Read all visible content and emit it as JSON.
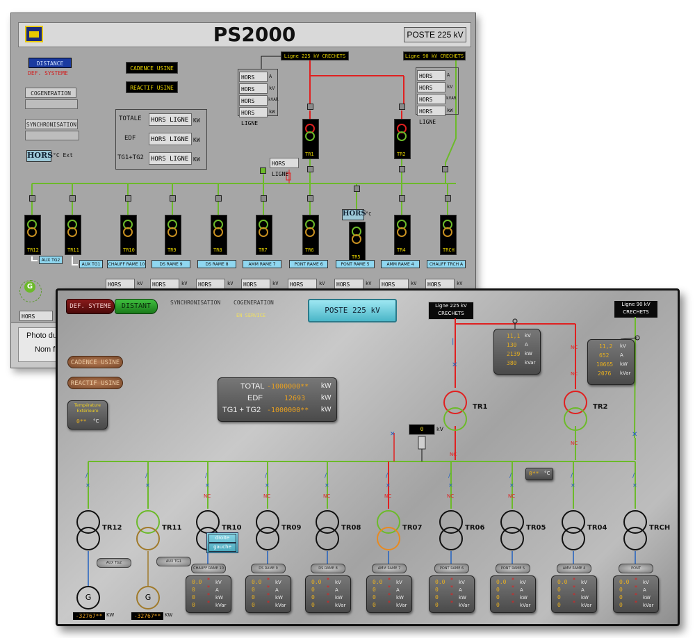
{
  "old_window": {
    "title": "PS2000",
    "poste": "POSTE 225 kV",
    "distance": "DISTANCE",
    "def_systeme": "DEF. SYSTEME",
    "cogeneration": "COGENERATION",
    "synchronisation": "SYNCHRONISATION",
    "hors_temp": "HORS",
    "temp_unit": "°C Ext",
    "cadence_usine": "CADENCE USINE",
    "reactif_usine": "REACTIF USINE",
    "totale": "TOTALE",
    "edf": "EDF",
    "tg1tg2": "TG1+TG2",
    "hors_ligne": "HORS LIGNE",
    "kw": "KW",
    "ligne_225": "Ligne 225 kV CRECHETS",
    "ligne_90": "Ligne 90 kV CRECHETS",
    "unit_a": "A",
    "unit_kv": "kV",
    "unit_kvar": "kVAR",
    "unit_kw_small": "kW",
    "tr1": "TR1",
    "tr2": "TR2",
    "hors_ligne_mid": "HORS LIGNE",
    "hors_tr5": "HORS",
    "deg_c": "°C",
    "transformers": [
      "TR12",
      "TR11",
      "TR10",
      "TR9",
      "TR8",
      "TR7",
      "TR6",
      "TR5",
      "TR4",
      "TRCH"
    ],
    "feeders": [
      "AUX TG2",
      "AUX TG1",
      "CHAUFF RAME 10",
      "DS RAME 9",
      "DS RAME 8",
      "AMM RAME 7",
      "PONT RAME 6",
      "PONT RAME 5",
      "AMM RAME 4",
      "CHAUFF TRCH A"
    ],
    "gen_label": "G",
    "photo_label": "Photo du ",
    "nom_label": "Nom fic"
  },
  "new_panel": {
    "def_syteme": "DEF. SYTEME",
    "distant": "DISTANT",
    "synchronisation": "SYNCHRONISATION",
    "cogeneration": "COGENERATION",
    "en_service": "EN SERVICE",
    "poste": "POSTE 225 kV",
    "ligne_225": [
      "Ligne 225 kV",
      "CRECHETS"
    ],
    "ligne_90": [
      "Ligne 90 kV",
      "CRECHETS"
    ],
    "cadence_usine": "CADENCE USINE",
    "reactif_usine": "REACTIF USINE",
    "temp_label": [
      "Température",
      "Extérieure"
    ],
    "temp_value": "0**",
    "temp_unit": "°C",
    "totals": {
      "total_label": "TOTAL",
      "total_value": "-1000000**",
      "edf_label": "EDF",
      "edf_value": "12693",
      "tg_label": "TG1 + TG2",
      "tg_value": "-1000000**",
      "unit": "kW"
    },
    "line225_meas": {
      "kv": "11,1",
      "a": "130",
      "kw": "2139",
      "kvar": "380"
    },
    "line90_meas": {
      "kv": "11,2",
      "a": "652",
      "kw": "10665",
      "kvar": "2076"
    },
    "units": {
      "kv": "kV",
      "a": "A",
      "kw": "kW",
      "kvar": "kVar"
    },
    "tr1": "TR1",
    "tr2": "TR2",
    "bus_kv_value": "0",
    "bus_kv_unit": "kV",
    "tr5_temp_value": "0**",
    "tr5_temp_unit": "°C",
    "nc": "NC",
    "transformers": [
      "TR12",
      "TR11",
      "TR10",
      "TR09",
      "TR08",
      "TR07",
      "TR06",
      "TR05",
      "TR04",
      "TRCH"
    ],
    "feeders": [
      "AUX TG2",
      "AUX TG1",
      "CHAUFF RAME 10",
      "DS RAME 9",
      "DS RAME 8",
      "AMM RAME 7",
      "PONT RAME 6",
      "PONT RAME 5",
      "AMM RAME 4",
      "PONT"
    ],
    "droite": "droite",
    "gauche": "gauche",
    "feeder_meas": {
      "kv": "0.0",
      "a": "0",
      "kw": "0",
      "kvar": "0"
    },
    "gen_label": "G",
    "gen_value": "-32767**",
    "gen_unit": "KW"
  }
}
